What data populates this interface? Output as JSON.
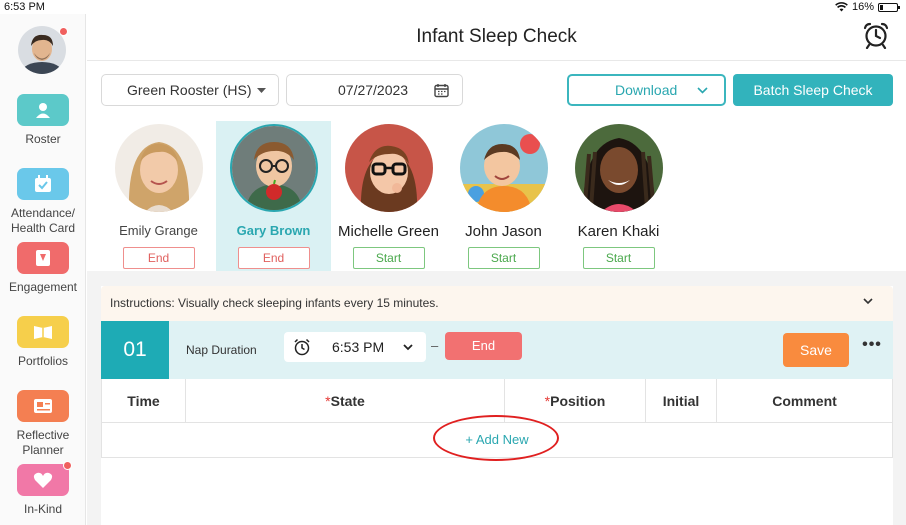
{
  "status_bar": {
    "time": "6:53 PM",
    "battery": "16%",
    "battery_level": 0.16
  },
  "sidebar": {
    "items": [
      {
        "label": "Roster",
        "icon": "roster-icon",
        "color": "#5cc9c9"
      },
      {
        "label": "Attendance/\nHealth Card",
        "icon": "calendar-check-icon",
        "color": "#6ac8ea"
      },
      {
        "label": "Engagement",
        "icon": "engagement-icon",
        "color": "#f06b6b"
      },
      {
        "label": "Portfolios",
        "icon": "portfolio-icon",
        "color": "#f6cf4b"
      },
      {
        "label": "Reflective\nPlanner",
        "icon": "planner-icon",
        "color": "#f47f52"
      },
      {
        "label": "In-Kind",
        "icon": "heart-icon",
        "color": "#f178a7"
      }
    ]
  },
  "header": {
    "title": "Infant Sleep Check"
  },
  "controls": {
    "classroom": "Green Rooster (HS)",
    "date": "07/27/2023",
    "download_label": "Download",
    "batch_label": "Batch Sleep Check"
  },
  "children": [
    {
      "name": "Emily Grange",
      "action": "End",
      "selected": false
    },
    {
      "name": "Gary Brown",
      "action": "End",
      "selected": true
    },
    {
      "name": "Michelle Green",
      "action": "Start",
      "selected": false
    },
    {
      "name": "John Jason",
      "action": "Start",
      "selected": false
    },
    {
      "name": "Karen Khaki",
      "action": "Start",
      "selected": false
    }
  ],
  "instructions": "Instructions: Visually check sleeping infants every 15 minutes.",
  "nap": {
    "number": "01",
    "duration_label": "Nap Duration",
    "start_time": "6:53 PM",
    "dash": "–",
    "end_label": "End",
    "save_label": "Save",
    "more_label": "•••"
  },
  "table": {
    "headers": {
      "time": "Time",
      "state": "State",
      "position": "Position",
      "initial": "Initial",
      "comment": "Comment"
    },
    "required_mark": "*",
    "add_new": "+ Add New"
  },
  "colors": {
    "accent": "#2aa7b0",
    "end_red": "#f27171",
    "save_orange": "#f98b3e",
    "highlight": "#e02020"
  }
}
